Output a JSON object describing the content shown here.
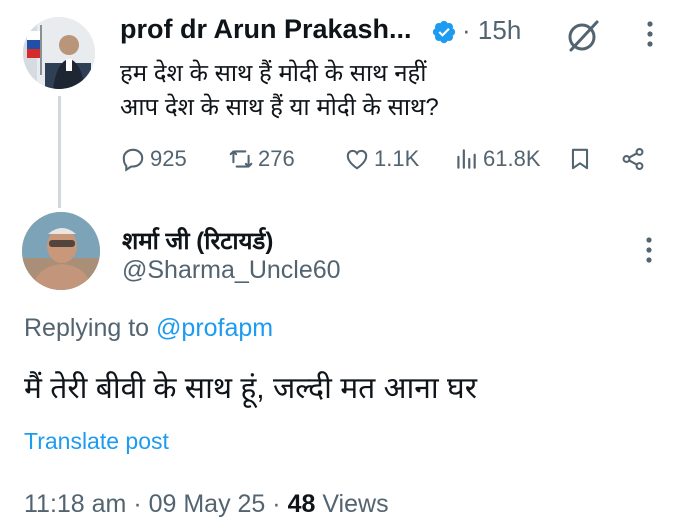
{
  "parent_tweet": {
    "author_name": "prof dr Arun Prakash...",
    "separator": "·",
    "time": "15h",
    "text": "हम देश के साथ हैं मोदी के साथ नहीं\nआप देश के साथ हैं या मोदी के साथ?",
    "stats": {
      "replies": "925",
      "retweets": "276",
      "likes": "1.1K",
      "views": "61.8K"
    }
  },
  "reply_tweet": {
    "author_name": "शर्मा जी (रिटायर्ड)",
    "handle": "@Sharma_Uncle60",
    "replying_prefix": "Replying to",
    "replying_to": "@profapm",
    "text": "मैं तेरी बीवी के साथ हूं, जल्दी मत आना घर",
    "translate_label": "Translate post",
    "timestamp": "11:18 am · 09 May 25 ·",
    "views_count": "48",
    "views_label": "Views"
  },
  "colors": {
    "primary_text": "#0f1419",
    "secondary_text": "#536471",
    "accent": "#1d9bf0",
    "thread_line": "#cfd9de"
  },
  "icons": [
    "verified-badge-icon",
    "grok-icon",
    "more-options-icon",
    "reply-icon",
    "retweet-icon",
    "like-icon",
    "views-icon",
    "bookmark-icon",
    "share-icon"
  ]
}
